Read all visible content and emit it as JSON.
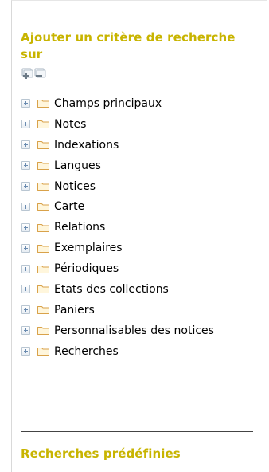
{
  "section": {
    "title": "Ajouter un critère de recherche sur",
    "expand_all_icon": "expand-all-icon",
    "collapse_all_icon": "collapse-all-icon"
  },
  "tree": {
    "items": [
      {
        "label": "Champs principaux"
      },
      {
        "label": "Notes"
      },
      {
        "label": "Indexations"
      },
      {
        "label": "Langues"
      },
      {
        "label": "Notices"
      },
      {
        "label": "Carte"
      },
      {
        "label": "Relations"
      },
      {
        "label": "Exemplaires"
      },
      {
        "label": "Périodiques"
      },
      {
        "label": "Etats des collections"
      },
      {
        "label": "Paniers"
      },
      {
        "label": "Personnalisables des notices"
      },
      {
        "label": "Recherches"
      }
    ]
  },
  "predefined": {
    "title": "Recherches prédéfinies"
  },
  "colors": {
    "accent_title": "#c8b400",
    "folder_outline": "#d9a24a",
    "folder_fill": "#fff6dc"
  }
}
